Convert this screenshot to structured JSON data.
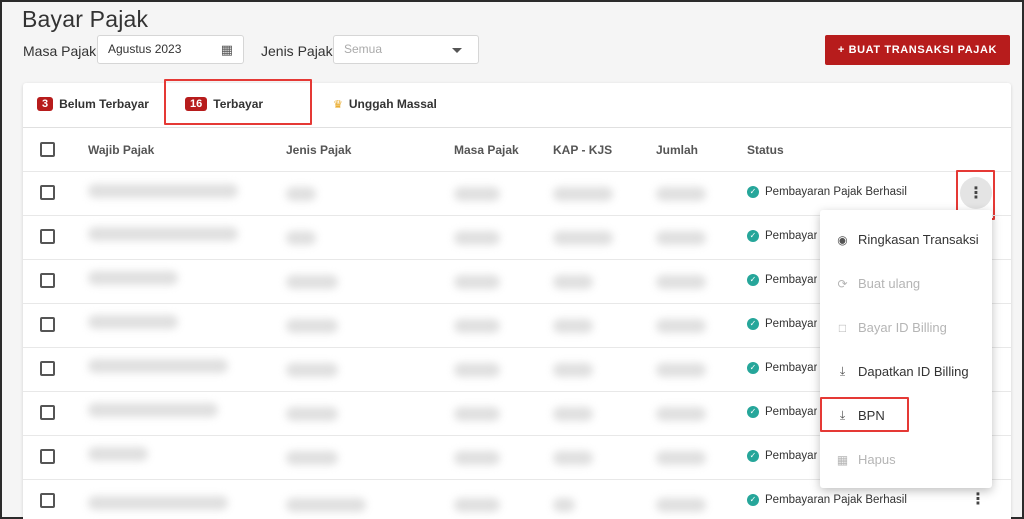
{
  "header": {
    "title": "Bayar Pajak",
    "masa_pajak_label": "Masa Pajak",
    "masa_pajak_value": "Agustus 2023",
    "jenis_pajak_label": "Jenis Pajak",
    "jenis_pajak_placeholder": "Semua",
    "create_button": "+ BUAT TRANSAKSI PAJAK"
  },
  "tabs": [
    {
      "count": "3",
      "label": "Belum Terbayar"
    },
    {
      "count": "16",
      "label": "Terbayar"
    },
    {
      "label": "Unggah Massal",
      "icon": "crown-icon"
    }
  ],
  "table": {
    "columns": [
      "Wajib Pajak",
      "Jenis Pajak",
      "Masa Pajak",
      "KAP - KJS",
      "Jumlah",
      "Status"
    ],
    "rows": [
      {
        "status": "Pembayaran Pajak Berhasil"
      },
      {
        "status": "Pembayaran Pajak Berhasil"
      },
      {
        "status": "Pembayaran Pajak Berhasil"
      },
      {
        "status": "Pembayaran Pajak Berhasil"
      },
      {
        "status": "Pembayaran Pajak Berhasil"
      },
      {
        "status": "Pembayaran Pajak Berhasil"
      },
      {
        "status": "Pembayaran Pajak Berhasil"
      },
      {
        "status": "Pembayaran Pajak Berhasil"
      }
    ]
  },
  "menu": {
    "items": [
      {
        "label": "Ringkasan Transaksi",
        "icon": "eye-icon",
        "enabled": true
      },
      {
        "label": "Buat ulang",
        "icon": "refresh-icon",
        "enabled": false
      },
      {
        "label": "Bayar ID Billing",
        "icon": "document-icon",
        "enabled": false
      },
      {
        "label": "Dapatkan ID Billing",
        "icon": "download-icon",
        "enabled": true
      },
      {
        "label": "BPN",
        "icon": "download-icon",
        "enabled": true
      },
      {
        "label": "Hapus",
        "icon": "trash-icon",
        "enabled": false
      }
    ]
  },
  "colors": {
    "brand": "#b71c1c",
    "success": "#26a69a",
    "highlight": "#e53935"
  }
}
